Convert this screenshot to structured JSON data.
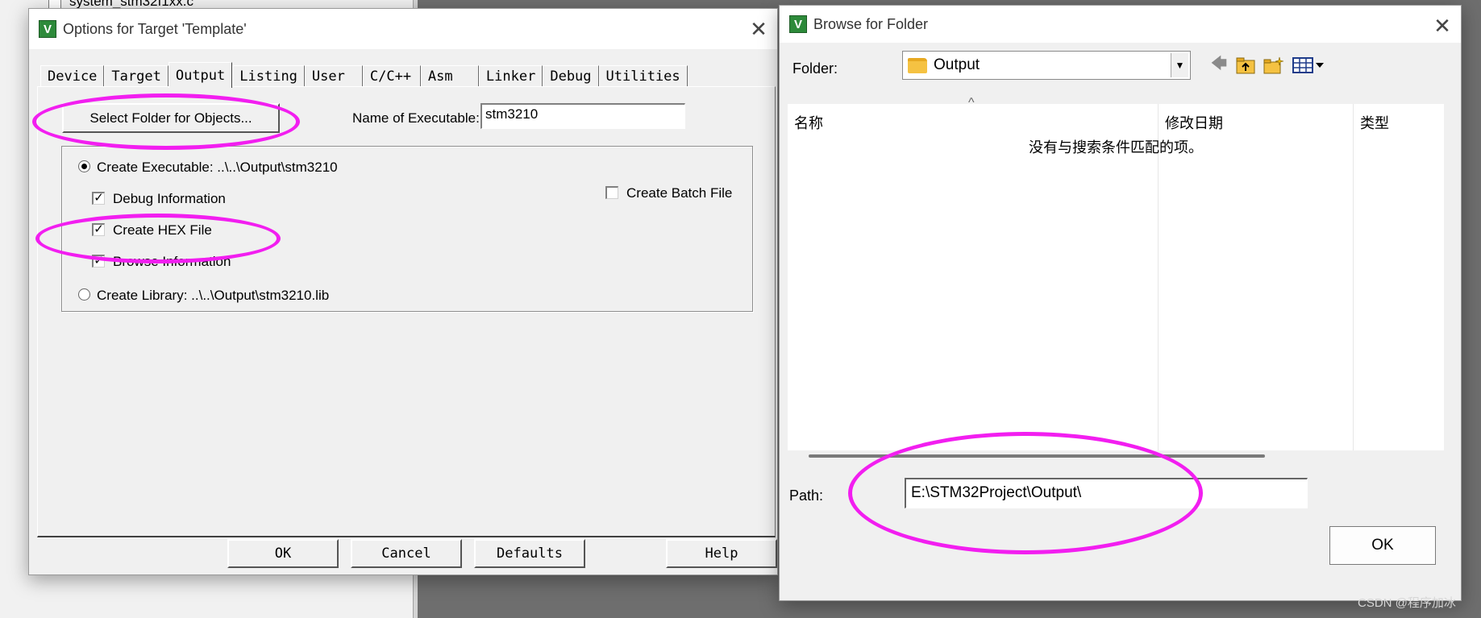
{
  "background": {
    "file_name": "system_stm32f1xx.c"
  },
  "options_dialog": {
    "title": "Options for Target 'Template'",
    "tabs": [
      "Device",
      "Target",
      "Output",
      "Listing",
      "User",
      "C/C++",
      "Asm",
      "Linker",
      "Debug",
      "Utilities"
    ],
    "active_tab": "Output",
    "select_folder_label": "Select Folder for Objects...",
    "name_of_executable_label": "Name of Executable:",
    "name_of_executable_value": "stm3210",
    "create_executable_label": "Create Executable:  ..\\..\\Output\\stm3210",
    "debug_info_label": "Debug Information",
    "create_hex_label": "Create HEX File",
    "browse_info_label": "Browse Information",
    "create_batch_label": "Create Batch File",
    "create_library_label": "Create Library:  ..\\..\\Output\\stm3210.lib",
    "buttons": {
      "ok": "OK",
      "cancel": "Cancel",
      "defaults": "Defaults",
      "help": "Help"
    }
  },
  "browse_dialog": {
    "title": "Browse for Folder",
    "folder_label": "Folder:",
    "folder_value": "Output",
    "columns": [
      "名称",
      "修改日期",
      "类型"
    ],
    "empty_message": "没有与搜索条件匹配的项。",
    "path_label": "Path:",
    "path_value": "E:\\STM32Project\\Output\\",
    "ok_label": "OK"
  },
  "watermark": "CSDN @程序加冰",
  "colors": {
    "annotation": "#f21ef0",
    "app_icon": "#2d8a3a"
  },
  "icons": {
    "app": "keil-uvision-icon",
    "back": "back-arrow-icon",
    "up": "up-folder-icon",
    "new_folder": "new-folder-icon",
    "view_menu": "view-menu-icon"
  }
}
